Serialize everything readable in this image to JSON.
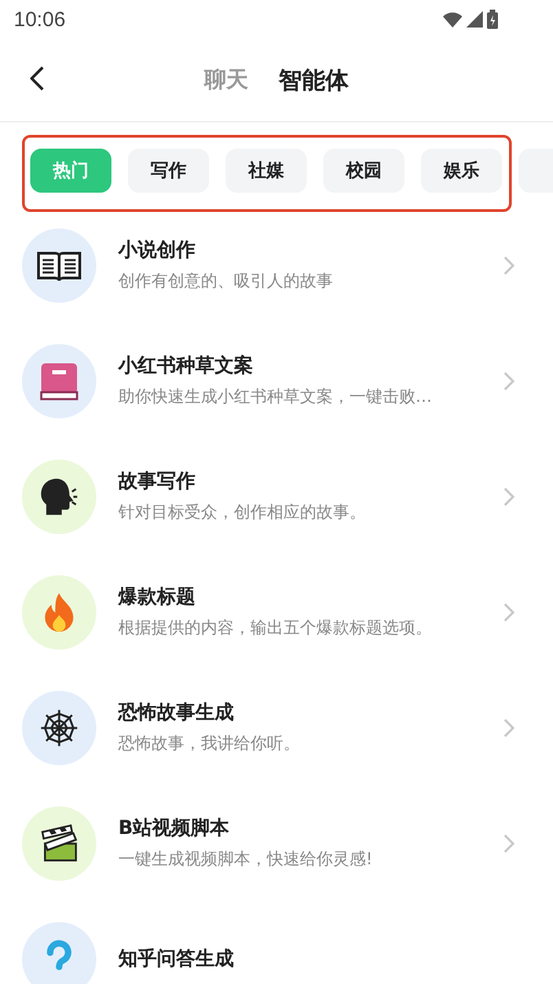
{
  "status_bar": {
    "time": "10:06"
  },
  "header": {
    "tabs": [
      {
        "label": "聊天",
        "selected": false
      },
      {
        "label": "智能体",
        "selected": true
      }
    ]
  },
  "categories": [
    {
      "label": "热门",
      "selected": true
    },
    {
      "label": "写作",
      "selected": false
    },
    {
      "label": "社媒",
      "selected": false
    },
    {
      "label": "校园",
      "selected": false
    },
    {
      "label": "娱乐",
      "selected": false
    },
    {
      "selected": false
    }
  ],
  "agents": [
    {
      "title": "小说创作",
      "description": "创作有创意的、吸引人的故事"
    },
    {
      "title": "小红书种草文案",
      "description": "助你快速生成小红书种草文案，一键击败…"
    },
    {
      "title": "故事写作",
      "description": "针对目标受众，创作相应的故事。"
    },
    {
      "title": "爆款标题",
      "description": "根据提供的内容，输出五个爆款标题选项。"
    },
    {
      "title": "恐怖故事生成",
      "description": "恐怖故事，我讲给你听。"
    },
    {
      "title": "B站视频脚本",
      "description": "一键生成视频脚本，快速给你灵感!"
    },
    {
      "title": "知乎问答生成"
    }
  ]
}
